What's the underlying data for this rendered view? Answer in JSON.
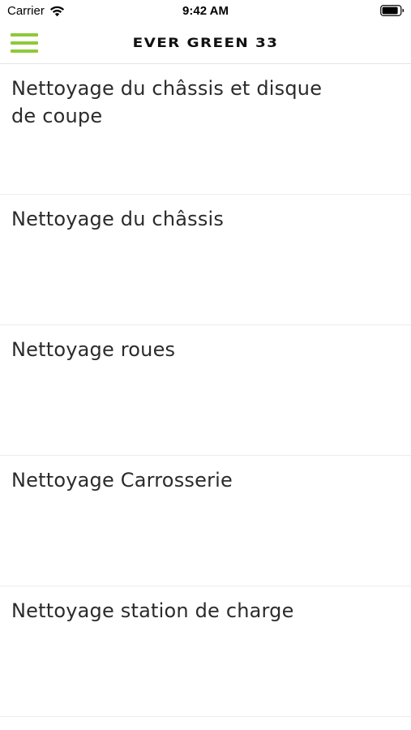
{
  "status_bar": {
    "carrier": "Carrier",
    "time": "9:42 AM",
    "wifi_icon": "wifi-icon",
    "battery_icon": "battery-icon"
  },
  "nav": {
    "menu_icon": "hamburger-menu-icon",
    "menu_color": "#8fc93a",
    "title": "EVER GREEN 33"
  },
  "tasks": [
    {
      "label": "Nettoyage du châssis et disque de coupe"
    },
    {
      "label": "Nettoyage du châssis"
    },
    {
      "label": "Nettoyage roues"
    },
    {
      "label": "Nettoyage Carrosserie"
    },
    {
      "label": "Nettoyage station de charge"
    }
  ]
}
